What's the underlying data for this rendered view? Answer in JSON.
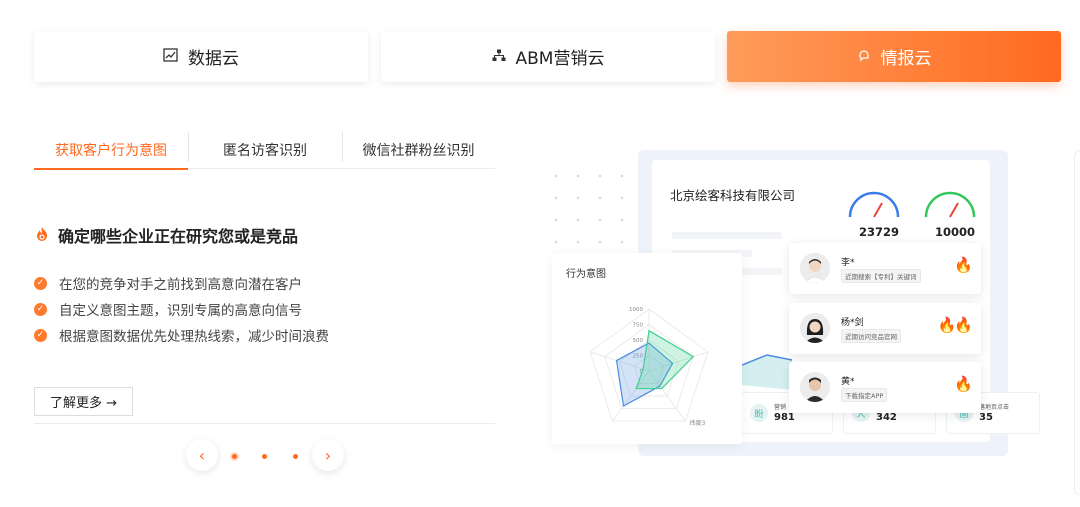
{
  "top_cards": [
    {
      "label": "数据云",
      "icon": "chart-icon"
    },
    {
      "label": "ABM营销云",
      "icon": "org-chart-icon"
    },
    {
      "label": "情报云",
      "icon": "brain-icon",
      "active": true
    }
  ],
  "tabs": [
    {
      "label": "获取客户行为意图",
      "active": true
    },
    {
      "label": "匿名访客识别"
    },
    {
      "label": "微信社群粉丝识别"
    }
  ],
  "feature": {
    "headline": "确定哪些企业正在研究您或是竞品",
    "bullets": [
      "在您的竞争对手之前找到高意向潜在客户",
      "自定义意图主题，识别专属的高意向信号",
      "根据意图数据优先处理热线索，减少时间浪费"
    ],
    "more_label": "了解更多 →"
  },
  "illustration": {
    "company": "北京绘客科技有限公司",
    "gauges": [
      {
        "value": "23729",
        "color": "#3b7be8"
      },
      {
        "value": "10000",
        "color": "#34c759"
      }
    ],
    "radar": {
      "title": "行为意图",
      "ticks": [
        "1000",
        "750",
        "500",
        "250",
        "0"
      ],
      "axis_label": "纬度3",
      "series": [
        {
          "color": "#4a8be0",
          "values": [
            0.45,
            0.4,
            0.3,
            0.7,
            0.55
          ]
        },
        {
          "color": "#3fcf8e",
          "values": [
            0.65,
            0.75,
            0.35,
            0.35,
            0.1
          ]
        }
      ]
    },
    "people": [
      {
        "name": "李*",
        "tag": "近期搜索【专利】关键词",
        "fires": "🔥"
      },
      {
        "name": "杨*剑",
        "tag": "近期访问竞品官网",
        "fires": "🔥🔥"
      },
      {
        "name": "黄*",
        "tag": "下载指定APP",
        "fires": "🔥"
      }
    ],
    "stats": [
      {
        "label": "营销",
        "value": "981",
        "icon": "盼"
      },
      {
        "label": "",
        "value": "342",
        "icon": "人"
      },
      {
        "label": "落地页点击",
        "value": "35",
        "icon": "画"
      }
    ]
  },
  "pager": {
    "prev": "‹",
    "next": "›",
    "count": 3,
    "active": 0
  }
}
